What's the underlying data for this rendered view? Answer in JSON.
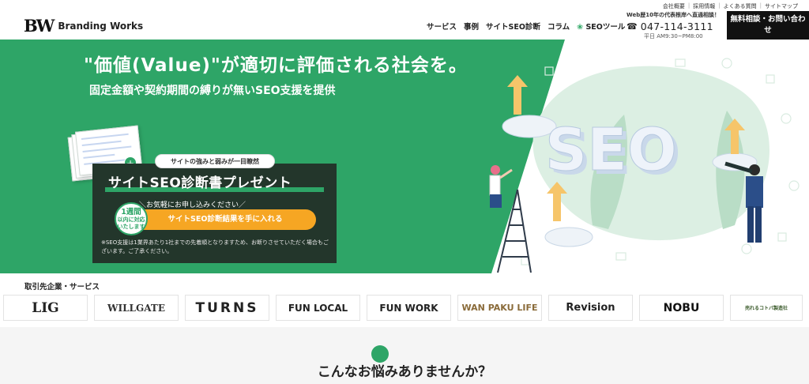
{
  "header": {
    "logo_mark": "BW",
    "logo_text": "Branding Works",
    "util_nav": [
      "会社概要",
      "採用情報",
      "よくある質問",
      "サイトマップ"
    ],
    "main_nav": [
      {
        "label": "サービス"
      },
      {
        "label": "事例"
      },
      {
        "label": "サイトSEO診断"
      },
      {
        "label": "コラム"
      },
      {
        "label": "SEOツール"
      }
    ],
    "contact_lead": "Web歴10年の代表根岸へ直通相談！",
    "phone": "047-114-3111",
    "hours": "平日 AM9:30~PM8:00",
    "cta_label": "無料相談・お問い合わせ"
  },
  "hero": {
    "headline": "\"価値(Value)\"が適切に評価される社会を。",
    "subheadline": "固定金額や契約期間の縛りが無いSEO支援を提供",
    "bubble_text": "サイトの強みと弱みが一目瞭然",
    "promo_title": "サイトSEO診断書プレゼント",
    "promo_lead": "＼お気軽にお申し込みください／",
    "badge_line1": "1週間",
    "badge_line2": "以内に対応いたします",
    "cta_label": "サイトSEO診断結果を手に入れる",
    "note": "※SEO支援は1業界あたり1社までの先着順となりますため、お断りさせていただく場合もございます。ご了承ください。",
    "art_text": "SEO"
  },
  "clients": {
    "title": "取引先企業・サービス",
    "logos": [
      "LIG",
      "WILLGATE",
      "TURNS",
      "FUN LOCAL",
      "FUN WORK",
      "WAN PAKU LIFE",
      "Revision",
      "NOBU",
      "売れるコトバ製造社"
    ]
  },
  "worries": {
    "title": "こんなお悩みありませんか？"
  },
  "colors": {
    "brand_green": "#2ea567",
    "dark_panel": "#23362b",
    "cta_orange": "#f6a623",
    "header_cta": "#111111"
  }
}
